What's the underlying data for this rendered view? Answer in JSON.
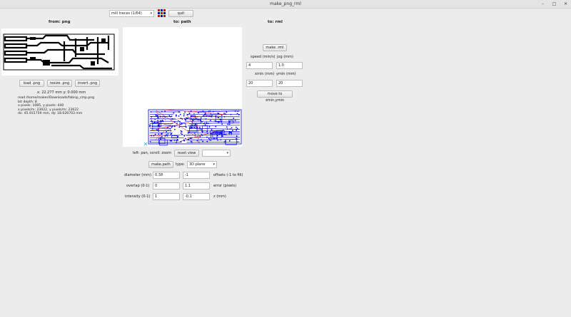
{
  "window": {
    "title": "make_png_rml"
  },
  "toolbar": {
    "process_selected": "mill traces (1/64)",
    "quit_label": "quit"
  },
  "headers": {
    "from": "from: png",
    "to_path": "to: path",
    "to_rml": "to: rml"
  },
  "png_panel": {
    "load_label": "load .png",
    "resize_label": "resize .png",
    "invert_label": "invert .png",
    "coords": "x: 22.277 mm  y: 0.000 mm",
    "info_lines": [
      "read /home/maker/Downloads/fabisp_cmp.png",
      "  bit depth: 8",
      "  x pixels: 1085, y pixels: 440",
      "  x pixels/m: 23622, y pixels/m: 23622",
      "  dx: 45.931759 mm, dy: 18.626703 mm"
    ]
  },
  "path_panel": {
    "view_hint": "left: pan, scroll: zoom",
    "reset_view_label": "reset view",
    "view_select": "",
    "make_path_label": "make.path",
    "type_label": "type:",
    "type_value": "3D plane",
    "diameter_label": "diameter (mm)",
    "diameter_value": "0.38",
    "offsets_value": "-1",
    "offsets_label": "offsets (-1 to fill)",
    "overlap_label": "overlap (0-1)",
    "overlap_value": "0",
    "error_value": "1.1",
    "error_label": "error (pixels)",
    "intensity_label": "intensity (0-1)",
    "intensity_value": "1",
    "z_value": "-0.1",
    "z_label": "z (mm)"
  },
  "rml_panel": {
    "make_rml_label": "make .rml",
    "speed_label": "speed (mm/s)",
    "jog_label": "jog (mm)",
    "speed_value": "4",
    "jog_value": "1.0",
    "xmin_label": "xmin (mm)",
    "ymin_label": "ymin (mm)",
    "xmin_value": "20",
    "ymin_value": "20",
    "move_label": "move to xmin,ymin"
  },
  "colors": {
    "trace": "#0000ee",
    "path": "#d00000",
    "dots": "#0000ff"
  },
  "icons": {
    "process_icon": "grid-icon"
  }
}
